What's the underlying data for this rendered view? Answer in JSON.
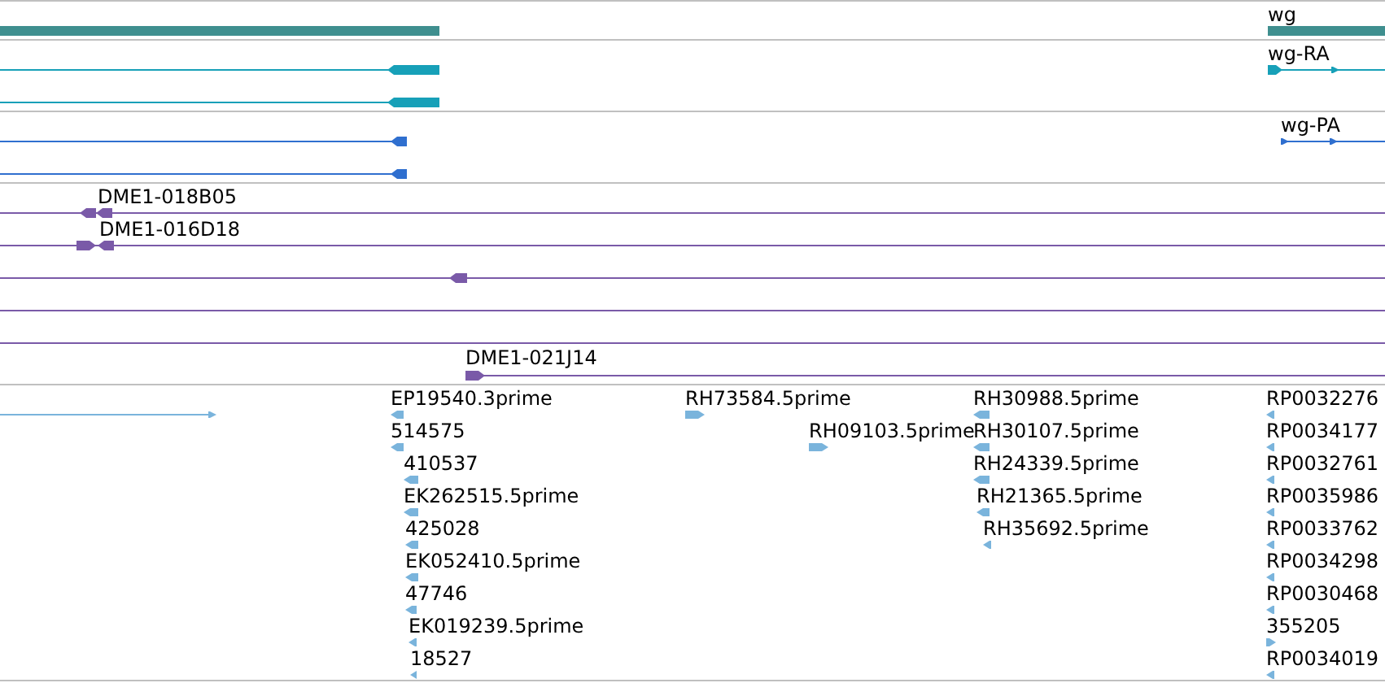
{
  "tracks": [
    {
      "kind": "gene",
      "labels": [
        "wg"
      ]
    },
    {
      "kind": "transcript",
      "labels": [
        "wg-RA"
      ]
    },
    {
      "kind": "protein",
      "labels": [
        "wg-PA"
      ]
    },
    {
      "kind": "clone",
      "labels": [
        "DME1-018B05",
        "DME1-016D18",
        "DME1-021J14"
      ]
    },
    {
      "kind": "est",
      "features": [
        {
          "label": "EP19540.3prime",
          "reverse": true
        },
        {
          "label": "514575",
          "reverse": true
        },
        {
          "label": "410537",
          "reverse": true
        },
        {
          "label": "EK262515.5prime",
          "reverse": true
        },
        {
          "label": "425028",
          "reverse": true
        },
        {
          "label": "EK052410.5prime",
          "reverse": true
        },
        {
          "label": "47746",
          "reverse": true
        },
        {
          "label": "EK019239.5prime",
          "reverse": true
        },
        {
          "label": "18527",
          "reverse": true
        },
        {
          "label": "RH73584.5prime",
          "reverse": false
        },
        {
          "label": "RH09103.5prime",
          "reverse": false
        },
        {
          "label": "RH30988.5prime",
          "reverse": true
        },
        {
          "label": "RH30107.5prime",
          "reverse": true
        },
        {
          "label": "RH24339.5prime",
          "reverse": true
        },
        {
          "label": "RH21365.5prime",
          "reverse": true
        },
        {
          "label": "RH35692.5prime",
          "reverse": true
        },
        {
          "label": "RP0032276",
          "reverse": true
        },
        {
          "label": "RP0034177",
          "reverse": true
        },
        {
          "label": "RP0032761",
          "reverse": true
        },
        {
          "label": "RP0035986",
          "reverse": true
        },
        {
          "label": "RP0033762",
          "reverse": true
        },
        {
          "label": "RP0034298",
          "reverse": true
        },
        {
          "label": "RP0030468",
          "reverse": true
        },
        {
          "label": "355205",
          "reverse": false
        },
        {
          "label": "RP0034019",
          "reverse": true
        }
      ]
    }
  ]
}
